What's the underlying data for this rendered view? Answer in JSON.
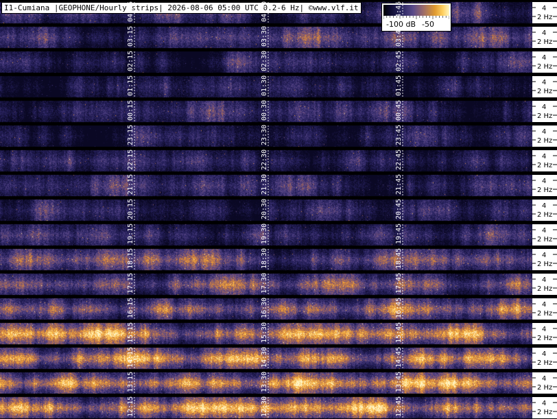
{
  "title": "I1-Cumiana |GEOPHONE/Hourly strips| 2026-08-06 05:00 UTC 0.2-6 Hz| ©www.vlf.it",
  "colorbar": {
    "low_label": "-100 dB",
    "high_label": "-50"
  },
  "freq_axis": {
    "top_label": "4",
    "bottom_label": "2 Hz"
  },
  "strips": [
    {
      "hour_start": "04:00",
      "marks": [
        "04:15",
        "04:30",
        "04:45"
      ],
      "intensity": 0.3
    },
    {
      "hour_start": "03:00",
      "marks": [
        "03:15",
        "03:30",
        "03:45"
      ],
      "intensity": 0.34
    },
    {
      "hour_start": "02:00",
      "marks": [
        "02:15",
        "02:30",
        "02:45"
      ],
      "intensity": 0.3
    },
    {
      "hour_start": "01:00",
      "marks": [
        "01:15",
        "01:30",
        "01:45"
      ],
      "intensity": 0.24
    },
    {
      "hour_start": "00:00",
      "marks": [
        "00:15",
        "00:30",
        "00:45"
      ],
      "intensity": 0.22
    },
    {
      "hour_start": "23:00",
      "marks": [
        "23:15",
        "23:30",
        "23:45"
      ],
      "intensity": 0.24
    },
    {
      "hour_start": "22:00",
      "marks": [
        "22:15",
        "22:30",
        "22:45"
      ],
      "intensity": 0.3
    },
    {
      "hour_start": "21:00",
      "marks": [
        "21:15",
        "21:30",
        "21:45"
      ],
      "intensity": 0.24
    },
    {
      "hour_start": "20:00",
      "marks": [
        "20:15",
        "20:30",
        "20:45"
      ],
      "intensity": 0.26
    },
    {
      "hour_start": "19:00",
      "marks": [
        "19:15",
        "19:30",
        "19:45"
      ],
      "intensity": 0.36
    },
    {
      "hour_start": "18:00",
      "marks": [
        "18:15",
        "18:30",
        "18:45"
      ],
      "intensity": 0.46
    },
    {
      "hour_start": "17:00",
      "marks": [
        "17:15",
        "17:30",
        "17:45"
      ],
      "intensity": 0.55
    },
    {
      "hour_start": "16:00",
      "marks": [
        "16:15",
        "16:30",
        "16:45"
      ],
      "intensity": 0.62
    },
    {
      "hour_start": "15:00",
      "marks": [
        "15:15",
        "15:30",
        "15:45"
      ],
      "intensity": 0.68
    },
    {
      "hour_start": "14:00",
      "marks": [
        "14:15",
        "14:30",
        "14:45"
      ],
      "intensity": 0.72
    },
    {
      "hour_start": "13:00",
      "marks": [
        "13:15",
        "13:30",
        "13:45"
      ],
      "intensity": 0.76
    },
    {
      "hour_start": "12:00",
      "marks": [
        "12:15",
        "12:30",
        "12:45"
      ],
      "intensity": 0.74
    }
  ],
  "colors": {
    "background": "#000000",
    "low": "#1a1648",
    "mid": "#5a4a8a",
    "high": "#ffb040",
    "peak": "#fff0b0",
    "grid": "#ffffff"
  }
}
